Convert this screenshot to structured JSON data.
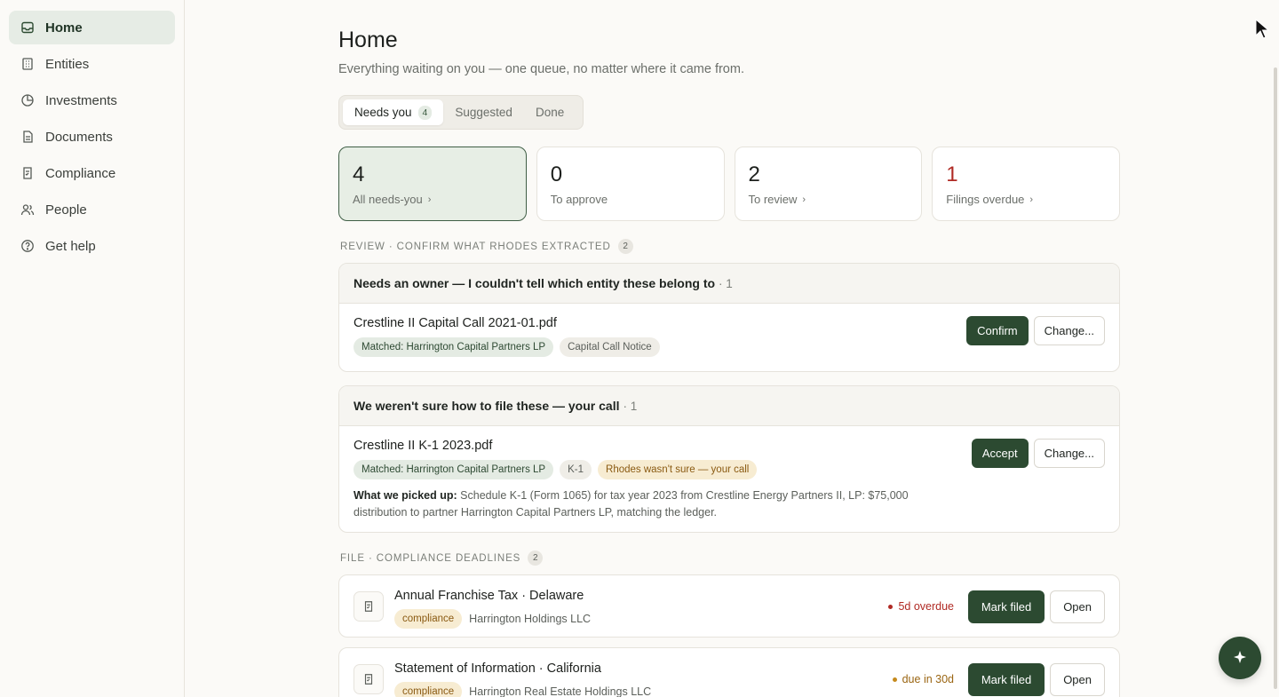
{
  "sidebar": {
    "items": [
      {
        "label": "Home",
        "icon": "inbox-icon",
        "active": true
      },
      {
        "label": "Entities",
        "icon": "building-icon"
      },
      {
        "label": "Investments",
        "icon": "pie-chart-icon"
      },
      {
        "label": "Documents",
        "icon": "document-icon"
      },
      {
        "label": "Compliance",
        "icon": "checklist-icon"
      },
      {
        "label": "People",
        "icon": "people-icon"
      },
      {
        "label": "Get help",
        "icon": "help-circle-icon"
      }
    ]
  },
  "header": {
    "title": "Home",
    "subtitle": "Everything waiting on you — one queue, no matter where it came from."
  },
  "tabs": [
    {
      "label": "Needs you",
      "count": "4",
      "active": true
    },
    {
      "label": "Suggested"
    },
    {
      "label": "Done"
    }
  ],
  "stats": [
    {
      "number": "4",
      "label": "All needs-you",
      "chevron": "›"
    },
    {
      "number": "0",
      "label": "To approve",
      "chevron": ""
    },
    {
      "number": "2",
      "label": "To review",
      "chevron": "›"
    },
    {
      "number": "1",
      "label": "Filings overdue",
      "chevron": "›"
    }
  ],
  "review": {
    "heading": "Review · Confirm what Rhodes extracted",
    "count": "2",
    "groups": [
      {
        "title": "Needs an owner — I couldn't tell which entity these belong to",
        "count": "· 1",
        "item": {
          "title": "Crestline II Capital Call 2021-01.pdf",
          "tags": [
            "Matched: Harrington Capital Partners LP",
            "Capital Call Notice"
          ],
          "primary": "Confirm",
          "secondary": "Change..."
        }
      },
      {
        "title": "We weren't sure how to file these — your call",
        "count": "· 1",
        "item": {
          "title": "Crestline II K-1 2023.pdf",
          "tags": [
            "Matched: Harrington Capital Partners LP",
            "K-1",
            "Rhodes wasn't sure — your call"
          ],
          "detail_label": "What we picked up:",
          "detail_text": " Schedule K-1 (Form 1065) for tax year 2023 from Crestline Energy Partners II, LP: $75,000 distribution to partner Harrington Capital Partners LP, matching the ledger.",
          "primary": "Accept",
          "secondary": "Change..."
        }
      }
    ]
  },
  "file": {
    "heading": "File · Compliance deadlines",
    "count": "2",
    "items": [
      {
        "title": "Annual Franchise Tax · Delaware",
        "tag": "compliance",
        "entity": "Harrington Holdings LLC",
        "status": "5d overdue",
        "status_color": "#b02a24",
        "primary": "Mark filed",
        "secondary": "Open"
      },
      {
        "title": "Statement of Information · California",
        "tag": "compliance",
        "entity": "Harrington Real Estate Holdings LLC",
        "status": "due in 30d",
        "status_color": "#9a6512",
        "primary": "Mark filed",
        "secondary": "Open"
      }
    ]
  },
  "colors": {
    "accent": "#2c4a31",
    "alert": "#b02a24",
    "warning": "#9a6512"
  }
}
